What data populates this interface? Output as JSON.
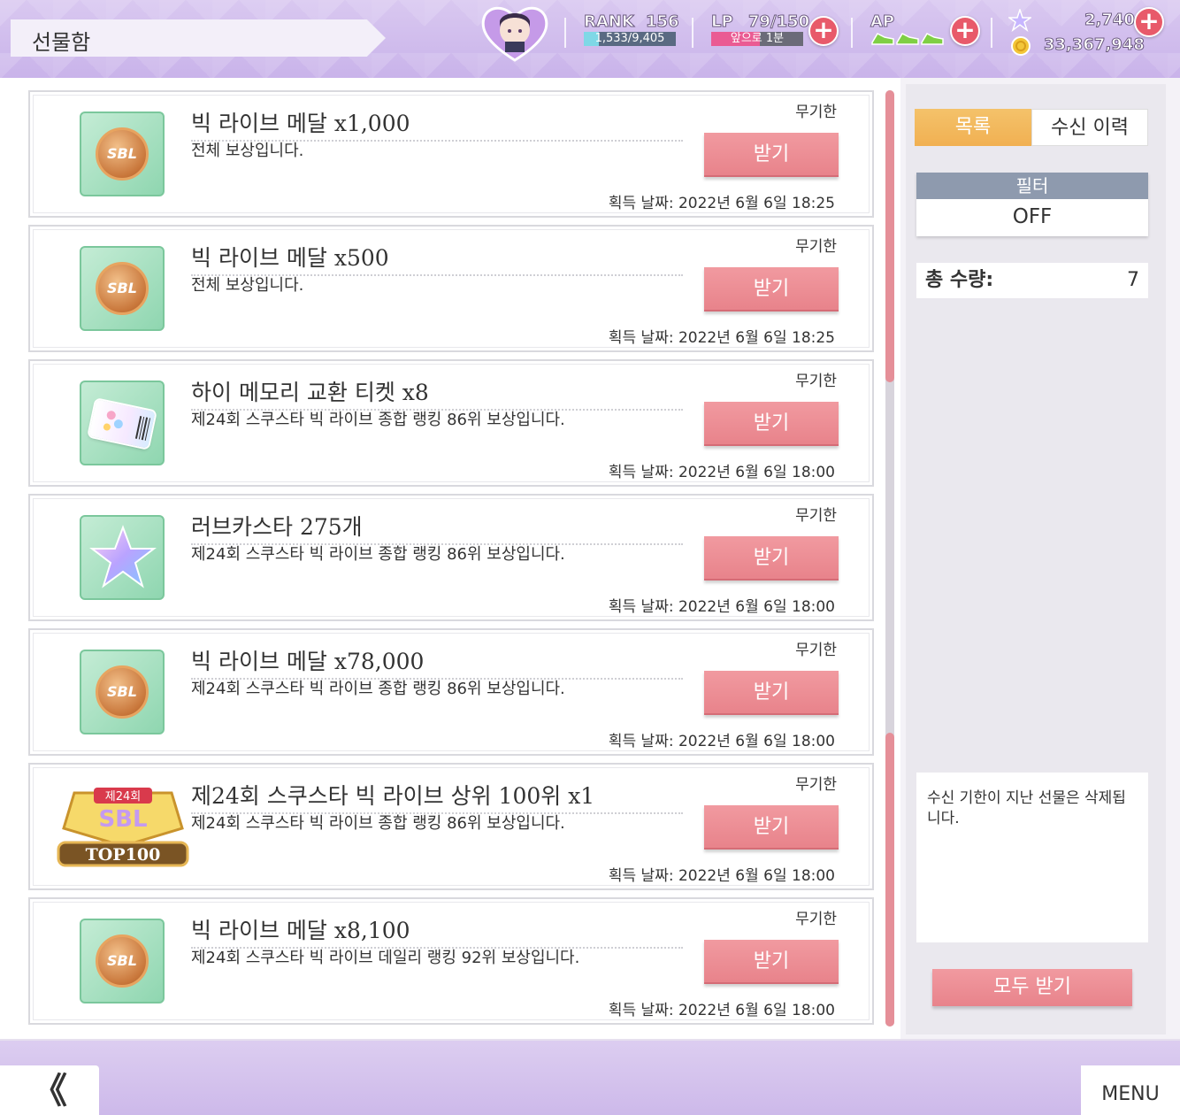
{
  "header": {
    "title": "선물함",
    "rank_label": "RANK",
    "rank_value": "156",
    "rank_exp": "1,533/9,405",
    "rank_exp_fraction": 0.163,
    "lp_label": "LP",
    "lp_value": "79/150",
    "lp_sub": "앞으로 1분",
    "lp_fraction": 0.53,
    "ap_label": "AP",
    "ap_filled": 3,
    "stars": "2,740",
    "coins": "33,367,948",
    "plus": "+"
  },
  "gifts": [
    {
      "icon": "medal-icon",
      "name": "빅 라이브 메달 x1,000",
      "desc": "전체 보상입니다.",
      "limit": "무기한",
      "button": "받기",
      "date": "획득 날짜: 2022년 6월 6일 18:25"
    },
    {
      "icon": "medal-icon",
      "name": "빅 라이브 메달 x500",
      "desc": "전체 보상입니다.",
      "limit": "무기한",
      "button": "받기",
      "date": "획득 날짜: 2022년 6월 6일 18:25"
    },
    {
      "icon": "ticket-icon",
      "name": "하이 메모리 교환 티켓 x8",
      "desc": "제24회 스쿠스타 빅 라이브 종합 랭킹 86위 보상입니다.",
      "limit": "무기한",
      "button": "받기",
      "date": "획득 날짜: 2022년 6월 6일 18:00"
    },
    {
      "icon": "lovecastar-icon",
      "name": "러브카스타 275개",
      "desc": "제24회 스쿠스타 빅 라이브 종합 랭킹 86위 보상입니다.",
      "limit": "무기한",
      "button": "받기",
      "date": "획득 날짜: 2022년 6월 6일 18:00"
    },
    {
      "icon": "medal-icon",
      "name": "빅 라이브 메달 x78,000",
      "desc": "제24회 스쿠스타 빅 라이브 종합 랭킹 86위 보상입니다.",
      "limit": "무기한",
      "button": "받기",
      "date": "획득 날짜: 2022년 6월 6일 18:00"
    },
    {
      "icon": "top100-badge-icon",
      "name": "제24회 스쿠스타 빅 라이브 상위 100위 x1",
      "desc": "제24회 스쿠스타 빅 라이브 종합 랭킹 86위 보상입니다.",
      "limit": "무기한",
      "button": "받기",
      "date": "획득 날짜: 2022년 6월 6일 18:00"
    },
    {
      "icon": "medal-icon",
      "name": "빅 라이브 메달 x8,100",
      "desc": "제24회 스쿠스타 빅 라이브 데일리 랭킹 92위 보상입니다.",
      "limit": "무기한",
      "button": "받기",
      "date": "획득 날짜: 2022년 6월 6일 18:00"
    }
  ],
  "icon_text": {
    "medal": "SBL",
    "badge_edition": "제24회",
    "badge_sbl": "SBL",
    "badge_top": "TOP100"
  },
  "side": {
    "tab_list": "목록",
    "tab_history": "수신 이력",
    "filter_label": "필터",
    "filter_value": "OFF",
    "total_label": "총 수량:",
    "total_value": "7",
    "notice": "수신 기한이 지난 선물은 삭제됩니다.",
    "receive_all": "모두 받기"
  },
  "footer": {
    "back": "《",
    "menu": "MENU"
  },
  "colors": {
    "accent_pink": "#e8838b",
    "tab_active": "#f1b052",
    "header_purple": "#c9b3ea"
  }
}
